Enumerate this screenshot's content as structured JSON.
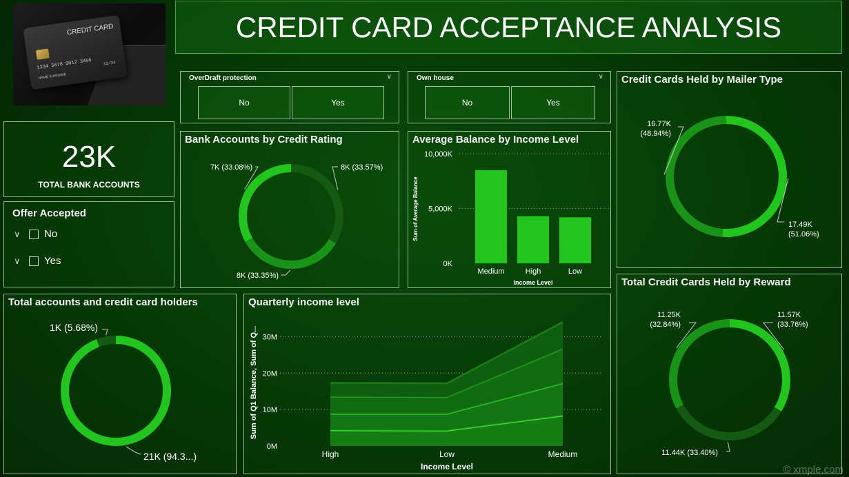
{
  "header": {
    "title": "CREDIT CARD ACCEPTANCE ANALYSIS"
  },
  "card_image": {
    "card_label": "CREDIT CARD",
    "card_number": "1234 5678 9012 3456",
    "card_name": "NAME SURNAME",
    "card_expiry": "12/34"
  },
  "kpi": {
    "value": "23K",
    "label": "TOTAL BANK ACCOUNTS"
  },
  "offer_slicer": {
    "title": "Offer Accepted",
    "options": [
      "No",
      "Yes"
    ]
  },
  "overdraft_slicer": {
    "title": "OverDraft protection",
    "options": [
      "No",
      "Yes"
    ]
  },
  "own_house_slicer": {
    "title": "Own house",
    "options": [
      "No",
      "Yes"
    ]
  },
  "watermark": "© xmple.com",
  "colors": {
    "bright": "#22c51e",
    "mid": "#1a9418",
    "dark": "#145a12",
    "darkest": "#0e4a0c"
  },
  "chart_data": [
    {
      "id": "credit_rating",
      "type": "pie",
      "title": "Bank Accounts by Credit Rating",
      "slices": [
        {
          "value": 33.57,
          "label": "8K (33.57%)",
          "color": "#145a12"
        },
        {
          "value": 33.35,
          "label": "8K (33.35%)",
          "color": "#1a9418"
        },
        {
          "value": 33.08,
          "label": "7K (33.08%)",
          "color": "#22c51e"
        }
      ]
    },
    {
      "id": "avg_balance",
      "type": "bar",
      "title": "Average Balance by Income Level",
      "categories": [
        "Medium",
        "High",
        "Low"
      ],
      "values": [
        8500,
        4300,
        4200
      ],
      "xlabel": "Income Level",
      "ylabel": "Sum of Average Balance",
      "ylim": [
        0,
        10000
      ],
      "yticks": [
        {
          "value": 0,
          "label": "0K"
        },
        {
          "value": 5000,
          "label": "5,000K"
        },
        {
          "value": 10000,
          "label": "10,000K"
        }
      ],
      "grid": true
    },
    {
      "id": "mailer_type",
      "type": "pie",
      "title": "Credit Cards Held by Mailer Type",
      "slices": [
        {
          "value": 51.06,
          "label": [
            "17.49K",
            "(51.06%)"
          ],
          "color": "#22c51e"
        },
        {
          "value": 48.94,
          "label": [
            "16.77K",
            "(48.94%)"
          ],
          "color": "#1a9418"
        }
      ]
    },
    {
      "id": "accounts_holders",
      "type": "pie",
      "title": "Total accounts and credit card holders",
      "slices": [
        {
          "value": 94.32,
          "label": "21K (94.3...)",
          "color": "#22c51e"
        },
        {
          "value": 5.68,
          "label": "1K (5.68%)",
          "color": "#145a12"
        }
      ]
    },
    {
      "id": "quarterly_income",
      "type": "area",
      "title": "Quarterly income level",
      "categories": [
        "High",
        "Low",
        "Medium"
      ],
      "series": [
        {
          "values": [
            4.3,
            4.2,
            8.3
          ]
        },
        {
          "values": [
            4.5,
            4.6,
            8.9
          ]
        },
        {
          "values": [
            4.7,
            4.6,
            9.5
          ]
        },
        {
          "values": [
            3.8,
            3.8,
            7.3
          ]
        }
      ],
      "xlabel": "Income Level",
      "ylabel": "Sum of Q1 Balance, Sum of Q...",
      "ylim": [
        0,
        35
      ],
      "yticks": [
        {
          "value": 0,
          "label": "0M"
        },
        {
          "value": 10,
          "label": "10M"
        },
        {
          "value": 20,
          "label": "20M"
        },
        {
          "value": 30,
          "label": "30M"
        }
      ],
      "grid": true
    },
    {
      "id": "reward",
      "type": "pie",
      "title": "Total Credit Cards Held by Reward",
      "slices": [
        {
          "value": 33.76,
          "label": [
            "11.57K",
            "(33.76%)"
          ],
          "color": "#22c51e"
        },
        {
          "value": 33.4,
          "label": "11.44K (33.40%)",
          "color": "#145a12"
        },
        {
          "value": 32.84,
          "label": [
            "11.25K",
            "(32.84%)"
          ],
          "color": "#1a9418"
        }
      ]
    }
  ]
}
